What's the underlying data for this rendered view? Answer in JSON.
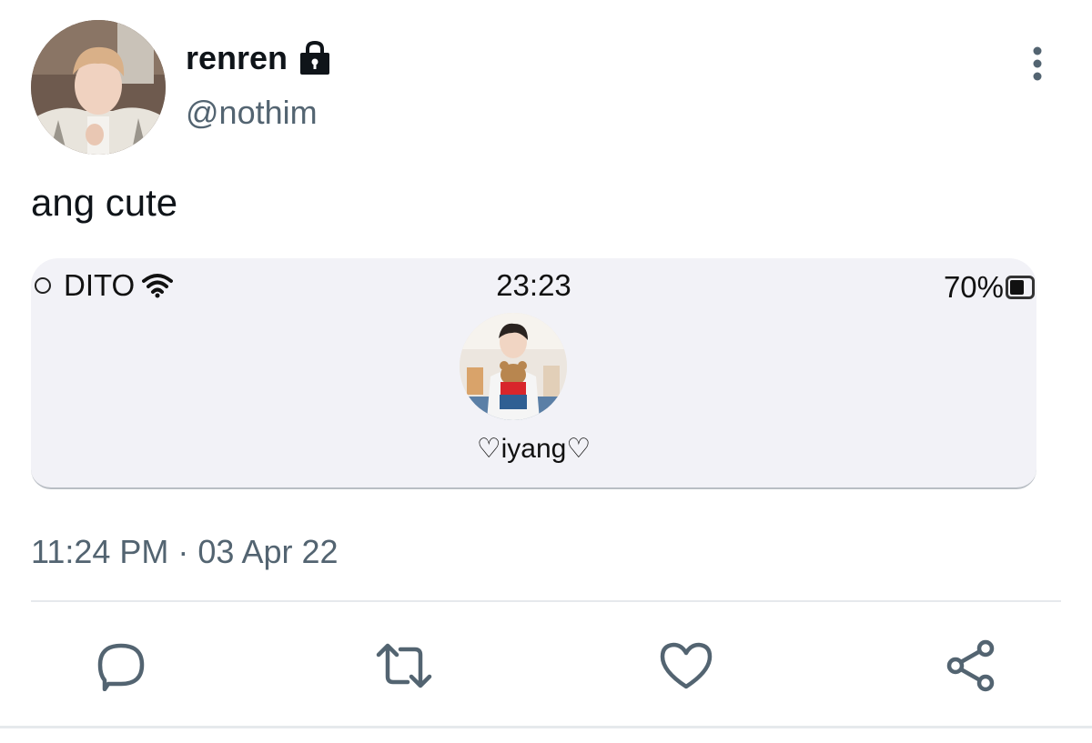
{
  "author": {
    "name": "renren",
    "handle": "@nothim"
  },
  "tweet": {
    "text": "ang cute",
    "timestamp": "11:24 PM · 03 Apr 22"
  },
  "media": {
    "status_bar": {
      "carrier": "DITO",
      "time": "23:23",
      "battery": "70%"
    },
    "contact_name": "♡iyang♡"
  },
  "icons": {
    "lock": "lock-icon",
    "more": "more-vertical-icon",
    "reply": "reply-icon",
    "retweet": "retweet-icon",
    "like": "heart-icon",
    "share": "share-icon",
    "wifi": "wifi-icon",
    "battery": "battery-icon"
  },
  "colors": {
    "text_primary": "#0f1419",
    "text_secondary": "#536471",
    "action_icon": "#536471",
    "media_background": "#f2f2f7",
    "divider": "#e6e9ec"
  }
}
